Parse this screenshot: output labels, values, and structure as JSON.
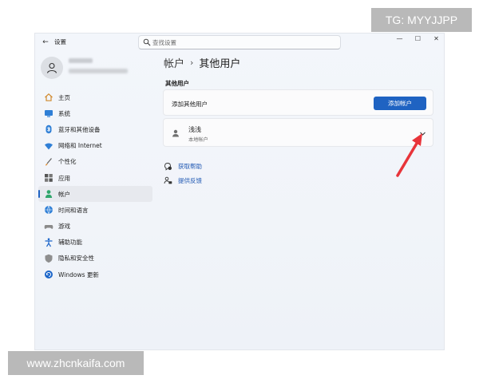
{
  "app": {
    "title": "设置"
  },
  "window_controls": {
    "minimize": "—",
    "maximize": "☐",
    "close": "✕"
  },
  "search": {
    "placeholder": "查找设置"
  },
  "nav": {
    "items": [
      {
        "label": "主页",
        "icon": "home-icon"
      },
      {
        "label": "系统",
        "icon": "system-icon"
      },
      {
        "label": "蓝牙和其他设备",
        "icon": "bluetooth-icon"
      },
      {
        "label": "网络和 Internet",
        "icon": "network-icon"
      },
      {
        "label": "个性化",
        "icon": "brush-icon"
      },
      {
        "label": "应用",
        "icon": "apps-icon"
      },
      {
        "label": "帐户",
        "icon": "account-icon",
        "active": true
      },
      {
        "label": "时间和语言",
        "icon": "globe-icon"
      },
      {
        "label": "游戏",
        "icon": "gamepad-icon"
      },
      {
        "label": "辅助功能",
        "icon": "accessibility-icon"
      },
      {
        "label": "隐私和安全性",
        "icon": "shield-icon"
      },
      {
        "label": "Windows 更新",
        "icon": "update-icon"
      }
    ]
  },
  "breadcrumb": {
    "parent": "帐户",
    "separator": "›",
    "current": "其他用户"
  },
  "section": {
    "title": "其他用户"
  },
  "add_user": {
    "text": "添加其他用户",
    "button_label": "添加帐户"
  },
  "user": {
    "name": "浅浅",
    "type": "本地帐户"
  },
  "links": [
    {
      "label": "获取帮助",
      "icon": "help-icon"
    },
    {
      "label": "提供反馈",
      "icon": "feedback-icon"
    }
  ],
  "watermarks": {
    "top": "TG: MYYJJPP",
    "bottom": "www.zhcnkaifa.com"
  },
  "colors": {
    "accent": "#1f63c2",
    "arrow": "#e8343a"
  }
}
